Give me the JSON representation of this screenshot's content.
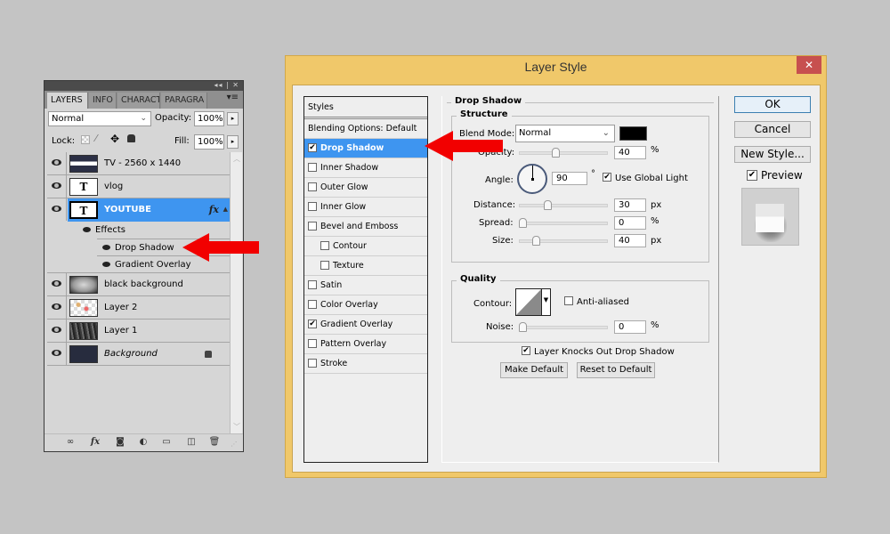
{
  "layers_panel": {
    "tabs": [
      "LAYERS",
      "INFO",
      "CHARACT",
      "PARAGRA"
    ],
    "active_tab": "LAYERS",
    "blend_mode": "Normal",
    "opacity_label": "Opacity:",
    "opacity_value": "100%",
    "lock_label": "Lock:",
    "fill_label": "Fill:",
    "fill_value": "100%",
    "layers": [
      {
        "name": "TV - 2560 x 1440",
        "thumb": "tv-pattern"
      },
      {
        "name": "vlog",
        "thumb": "text-layer"
      },
      {
        "name": "YOUTUBE",
        "thumb": "text-layer",
        "selected": true,
        "fx": "fx"
      },
      {
        "name": "black background",
        "thumb": "vignette"
      },
      {
        "name": "Layer 2",
        "thumb": "transparent-dots"
      },
      {
        "name": "Layer 1",
        "thumb": "photo"
      },
      {
        "name": "Background",
        "thumb": "dark-navy",
        "locked": true
      }
    ],
    "effects_label": "Effects",
    "effects": [
      "Drop Shadow",
      "Gradient Overlay"
    ],
    "text_thumb_glyph": "T",
    "bottom_icons": [
      "link-icon",
      "fx-icon",
      "mask-icon",
      "adjustment-icon",
      "folder-icon",
      "new-layer-icon",
      "trash-icon"
    ]
  },
  "dialog": {
    "title": "Layer Style",
    "close_glyph": "✕",
    "styles_header": "Styles",
    "blending_options": "Blending Options: Default",
    "styles": [
      {
        "label": "Drop Shadow",
        "checked": true,
        "selected": true,
        "indent": false
      },
      {
        "label": "Inner Shadow",
        "checked": false,
        "indent": false
      },
      {
        "label": "Outer Glow",
        "checked": false,
        "indent": false
      },
      {
        "label": "Inner Glow",
        "checked": false,
        "indent": false
      },
      {
        "label": "Bevel and Emboss",
        "checked": false,
        "indent": false
      },
      {
        "label": "Contour",
        "checked": false,
        "indent": true
      },
      {
        "label": "Texture",
        "checked": false,
        "indent": true
      },
      {
        "label": "Satin",
        "checked": false,
        "indent": false
      },
      {
        "label": "Color Overlay",
        "checked": false,
        "indent": false
      },
      {
        "label": "Gradient Overlay",
        "checked": true,
        "indent": false
      },
      {
        "label": "Pattern Overlay",
        "checked": false,
        "indent": false
      },
      {
        "label": "Stroke",
        "checked": false,
        "indent": false
      }
    ],
    "section_title": "Drop Shadow",
    "structure": {
      "title": "Structure",
      "blend_mode_label": "Blend Mode:",
      "blend_mode_value": "Normal",
      "shadow_color": "#000000",
      "opacity_label": "Opacity:",
      "opacity_value": "40",
      "opacity_unit": "%",
      "angle_label": "Angle:",
      "angle_value": "90",
      "angle_unit": "°",
      "use_global_light_label": "Use Global Light",
      "use_global_light": true,
      "distance_label": "Distance:",
      "distance_value": "30",
      "distance_unit": "px",
      "spread_label": "Spread:",
      "spread_value": "0",
      "spread_unit": "%",
      "size_label": "Size:",
      "size_value": "40",
      "size_unit": "px"
    },
    "quality": {
      "title": "Quality",
      "contour_label": "Contour:",
      "anti_aliased_label": "Anti-aliased",
      "anti_aliased": false,
      "noise_label": "Noise:",
      "noise_value": "0",
      "noise_unit": "%"
    },
    "knockout_label": "Layer Knocks Out Drop Shadow",
    "knockout_checked": true,
    "make_default_label": "Make Default",
    "reset_default_label": "Reset to Default",
    "ok_label": "OK",
    "cancel_label": "Cancel",
    "new_style_label": "New Style...",
    "preview_label": "Preview",
    "preview_checked": true
  },
  "colors": {
    "selection_blue": "#3e95f0",
    "annotation_red": "#f20000",
    "dialog_frame": "#f0c86a",
    "close_button": "#c7504f"
  }
}
